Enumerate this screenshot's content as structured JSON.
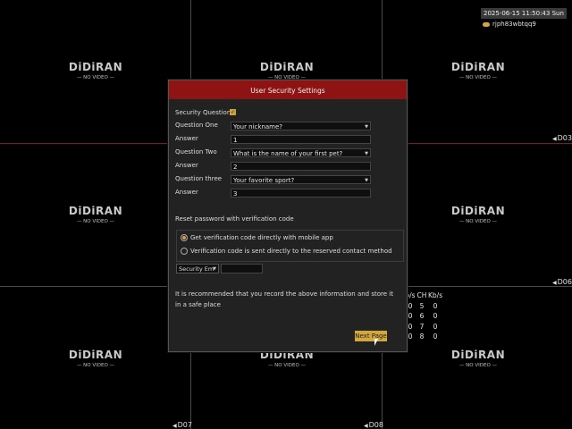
{
  "overlay": {
    "datetime": "2025-06-15 11:50:43 Sun",
    "device_id": "rjph83wbtqq9"
  },
  "cells": {
    "brand": "DiDiRAN",
    "no_video": "— NO VIDEO —"
  },
  "camera_labels": {
    "d03": "D03",
    "d06": "D06",
    "d07": "D07",
    "d08": "D08"
  },
  "stats": {
    "headers": [
      "b/s",
      "CH",
      "Kb/s"
    ],
    "rows": [
      [
        "0",
        "5",
        "0"
      ],
      [
        "0",
        "6",
        "0"
      ],
      [
        "0",
        "7",
        "0"
      ],
      [
        "0",
        "8",
        "0"
      ]
    ]
  },
  "dialog": {
    "title": "User Security Settings",
    "security_question_label": "Security Question",
    "q1_label": "Question One",
    "q1_value": "Your nickname?",
    "a1_label": "Answer",
    "a1_value": "1",
    "q2_label": "Question Two",
    "q2_value": "What is the name of your first pet?",
    "a2_label": "Answer",
    "a2_value": "2",
    "q3_label": "Question three",
    "q3_value": "Your favorite sport?",
    "a3_label": "Answer",
    "a3_value": "3",
    "reset_section": "Reset password with verification code",
    "option1": "Get verification code directly with mobile app",
    "option2": "Verification code is sent directly to the reserved contact method",
    "email_select": "Security Em",
    "note": "It is recommended that you record the above information and store it in a safe place",
    "next_button": "Next Page"
  }
}
